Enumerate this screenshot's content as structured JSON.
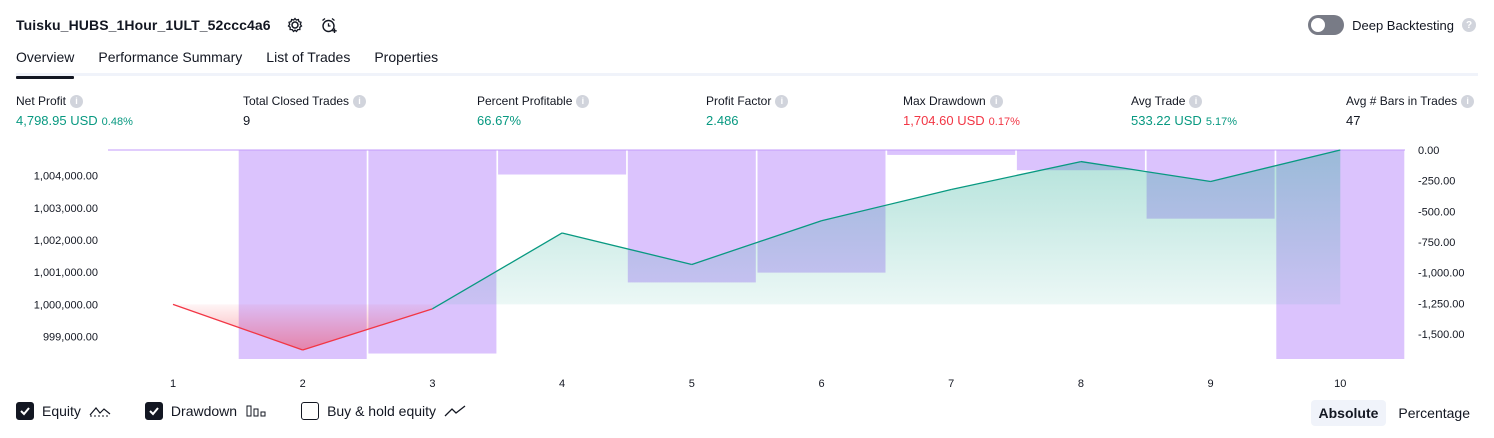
{
  "header": {
    "strategy_name": "Tuisku_HUBS_1Hour_1ULT_52ccc4a6",
    "settings_icon": "gear-icon",
    "alert_icon": "alarm-clock-plus-icon",
    "deep_backtesting_label": "Deep Backtesting",
    "deep_backtesting_on": false
  },
  "tabs": [
    {
      "label": "Overview",
      "active": true
    },
    {
      "label": "Performance Summary",
      "active": false
    },
    {
      "label": "List of Trades",
      "active": false
    },
    {
      "label": "Properties",
      "active": false
    }
  ],
  "stats": [
    {
      "label": "Net Profit",
      "value": "4,798.95 USD",
      "pct": "0.48%",
      "tone": "pos"
    },
    {
      "label": "Total Closed Trades",
      "value": "9",
      "pct": "",
      "tone": "plain"
    },
    {
      "label": "Percent Profitable",
      "value": "66.67%",
      "pct": "",
      "tone": "pos"
    },
    {
      "label": "Profit Factor",
      "value": "2.486",
      "pct": "",
      "tone": "pos"
    },
    {
      "label": "Max Drawdown",
      "value": "1,704.60 USD",
      "pct": "0.17%",
      "tone": "neg"
    },
    {
      "label": "Avg Trade",
      "value": "533.22 USD",
      "pct": "5.17%",
      "tone": "pos"
    },
    {
      "label": "Avg # Bars in Trades",
      "value": "47",
      "pct": "",
      "tone": "plain"
    }
  ],
  "chart_data": {
    "type": "line",
    "x": [
      1,
      2,
      3,
      4,
      5,
      6,
      7,
      8,
      9,
      10
    ],
    "xticks": [
      "1",
      "2",
      "3",
      "4",
      "5",
      "6",
      "7",
      "8",
      "9",
      "10"
    ],
    "baseline": 1000000,
    "series": [
      {
        "name": "Equity",
        "values": [
          1000000,
          998580,
          999860,
          1002220,
          1001240,
          1002600,
          1003570,
          1004440,
          1003820,
          1004800
        ]
      },
      {
        "name": "Drawdown",
        "values": [
          0,
          -1704.6,
          -1660,
          -200,
          -1080,
          -1000,
          -40,
          -165,
          -560,
          -1704.6
        ]
      }
    ],
    "left_axis": {
      "ylim": [
        998300,
        1004800
      ],
      "ticks": [
        "1,004,000.00",
        "1,003,000.00",
        "1,002,000.00",
        "1,001,000.00",
        "1,000,000.00",
        "999,000.00"
      ],
      "tick_values": [
        1004000,
        1003000,
        1002000,
        1001000,
        1000000,
        999000
      ]
    },
    "right_axis": {
      "ylim": [
        -1704.6,
        0
      ],
      "ticks": [
        "0.00",
        "-250.00",
        "-500.00",
        "-750.00",
        "-1,000.00",
        "-1,250.00",
        "-1,500.00"
      ],
      "tick_values": [
        0,
        -250,
        -500,
        -750,
        -1000,
        -1250,
        -1500
      ]
    },
    "colors": {
      "equity_up": "#089981",
      "equity_down": "#f23645",
      "drawdown": "#c39bfb",
      "overlap": "#5b9cf6"
    }
  },
  "legend": [
    {
      "label": "Equity",
      "checked": true,
      "icon": "equity-line-icon"
    },
    {
      "label": "Drawdown",
      "checked": true,
      "icon": "drawdown-bars-icon"
    },
    {
      "label": "Buy & hold equity",
      "checked": false,
      "icon": "buy-hold-line-icon"
    }
  ],
  "scale": {
    "absolute": "Absolute",
    "percentage": "Percentage",
    "selected": "absolute"
  }
}
